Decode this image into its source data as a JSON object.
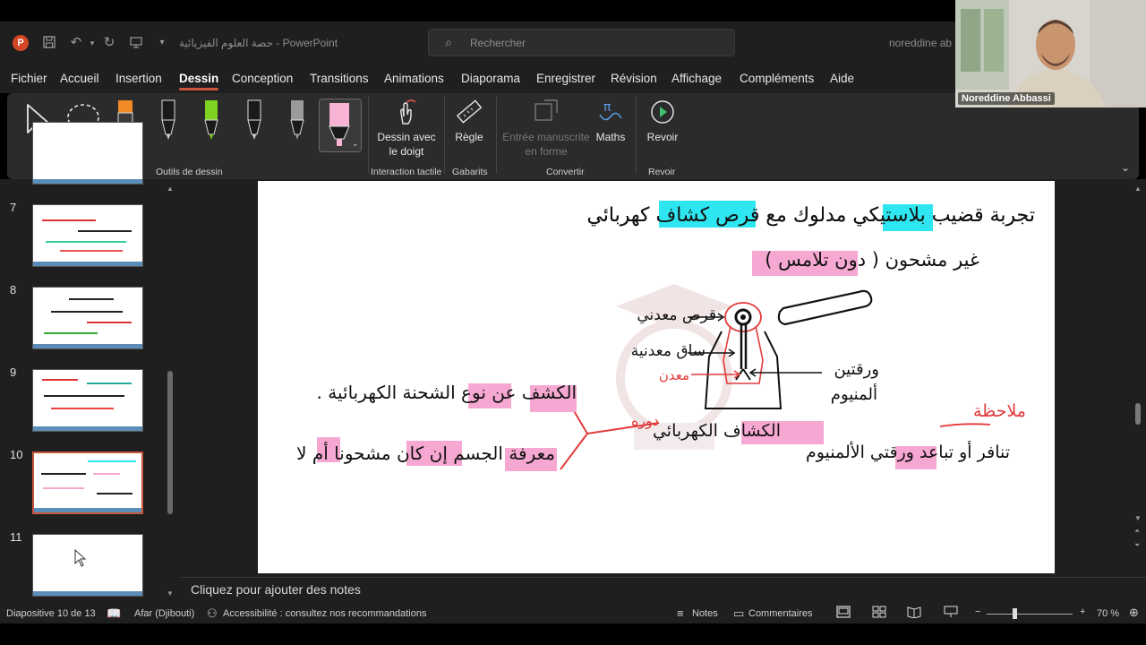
{
  "titlebar": {
    "doc_title": "حصة العلوم الفيزيائية  -  PowerPoint",
    "search_placeholder": "Rechercher",
    "user": "noreddine ab"
  },
  "menu": {
    "items": [
      "Fichier",
      "Accueil",
      "Insertion",
      "Dessin",
      "Conception",
      "Transitions",
      "Animations",
      "Diaporama",
      "Enregistrer",
      "Révision",
      "Affichage",
      "Compléments",
      "Aide"
    ],
    "active": "Dessin"
  },
  "ribbon": {
    "groups": {
      "drawing_tools": "Outils de dessin",
      "touch": "Interaction tactile",
      "templates": "Gabarits",
      "convert": "Convertir",
      "replay": "Revoir"
    },
    "buttons": {
      "draw_finger_line1": "Dessin avec",
      "draw_finger_line2": "le doigt",
      "ruler": "Règle",
      "ink_to_shape_line1": "Entrée manuscrite",
      "ink_to_shape_line2": "en forme",
      "math": "Maths",
      "replay": "Revoir"
    },
    "pens": [
      {
        "name": "highlighter-orange-purple",
        "color": "#f08a24",
        "tip": "#9b3dc4"
      },
      {
        "name": "pen-black-1",
        "color": "#1a1a1a"
      },
      {
        "name": "pen-green",
        "color": "#7ed321"
      },
      {
        "name": "pen-black-2",
        "color": "#1a1a1a"
      },
      {
        "name": "pencil-gray",
        "color": "#9a9a9a"
      },
      {
        "name": "highlighter-pink",
        "color": "#f7b2d4"
      }
    ]
  },
  "thumbnails": [
    {
      "num": "7"
    },
    {
      "num": "8"
    },
    {
      "num": "9"
    },
    {
      "num": "10",
      "selected": true
    },
    {
      "num": "11"
    }
  ],
  "notes": {
    "placeholder": "Cliquez pour ajouter des notes"
  },
  "status": {
    "slide_counter": "Diapositive 10 de 13",
    "language": "Afar (Djibouti)",
    "accessibility": "Accessibilité : consultez nos recommandations",
    "notes_btn": "Notes",
    "comments_btn": "Commentaires",
    "zoom": "70 %"
  },
  "webcam": {
    "name": "Noreddine Abbassi"
  },
  "slide": {
    "line1": "تجربة قضيب بلاستيكي مدلوك مع قرص كشاف كهربائي",
    "line2": "غير مشحون ( دون تلامس )",
    "label_disc": "قرص معدني",
    "label_rod": "ساق معدنية",
    "label_metal": "معدن",
    "label_leaves_1": "ورقتين",
    "label_leaves_2": "ألمنيوم",
    "electroscope": "الكشاف الكهربائي",
    "role": "دوره",
    "left_1": "الكشف عن نوع الشحنة الكهربائية .",
    "left_2": "معرفة الجسم إن كان مشحونا أم لا",
    "observation": "ملاحظة",
    "obs_text": "تنافر أو تباعد ورقتي الألمنيوم"
  }
}
